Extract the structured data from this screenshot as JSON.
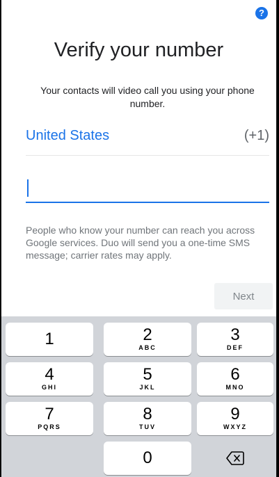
{
  "header": {
    "help_icon": "?",
    "title": "Verify your number",
    "subtitle": "Your contacts will video call you using your phone number."
  },
  "country": {
    "name": "United States",
    "code": "(+1)"
  },
  "phone_input": {
    "value": "",
    "placeholder": ""
  },
  "disclaimer": "People who know your number can reach you across Google services. Duo will send you a one-time SMS message; carrier rates may apply.",
  "next_button": "Next",
  "keypad": {
    "keys": [
      {
        "num": "1",
        "letters": ""
      },
      {
        "num": "2",
        "letters": "ABC"
      },
      {
        "num": "3",
        "letters": "DEF"
      },
      {
        "num": "4",
        "letters": "GHI"
      },
      {
        "num": "5",
        "letters": "JKL"
      },
      {
        "num": "6",
        "letters": "MNO"
      },
      {
        "num": "7",
        "letters": "PQRS"
      },
      {
        "num": "8",
        "letters": "TUV"
      },
      {
        "num": "9",
        "letters": "WXYZ"
      },
      {
        "num": "0",
        "letters": ""
      }
    ],
    "backspace_icon": "backspace-icon"
  },
  "colors": {
    "accent": "#1a73e8",
    "keyboard_bg": "#d1d4d9"
  }
}
